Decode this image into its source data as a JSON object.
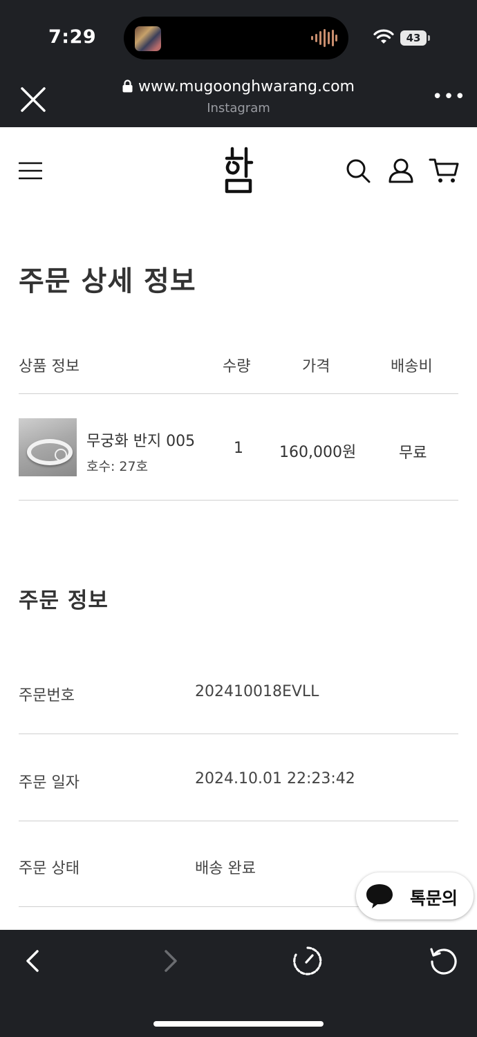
{
  "status_bar": {
    "time": "7:29",
    "battery": "43"
  },
  "browser": {
    "url": "www.mugoonghwarang.com",
    "source": "Instagram",
    "more_label": "•••"
  },
  "page": {
    "title": "주문 상세 정보",
    "table_headers": {
      "product": "상품 정보",
      "qty": "수량",
      "price": "가격",
      "shipping": "배송비"
    },
    "item": {
      "name": "무궁화 반지 005",
      "option": "호수: 27호",
      "qty": "1",
      "price": "160,000원",
      "shipping": "무료"
    },
    "order_section_title": "주문 정보",
    "order_info": [
      {
        "label": "주문번호",
        "value": "202410018EVLL"
      },
      {
        "label": "주문 일자",
        "value": "2024.10.01 22:23:42"
      },
      {
        "label": "주문 상태",
        "value": "배송 완료"
      }
    ]
  },
  "chat": {
    "label": "톡문의"
  },
  "colors": {
    "chrome": "#1f2125",
    "text": "#333333",
    "divider": "#cfcfcf"
  }
}
